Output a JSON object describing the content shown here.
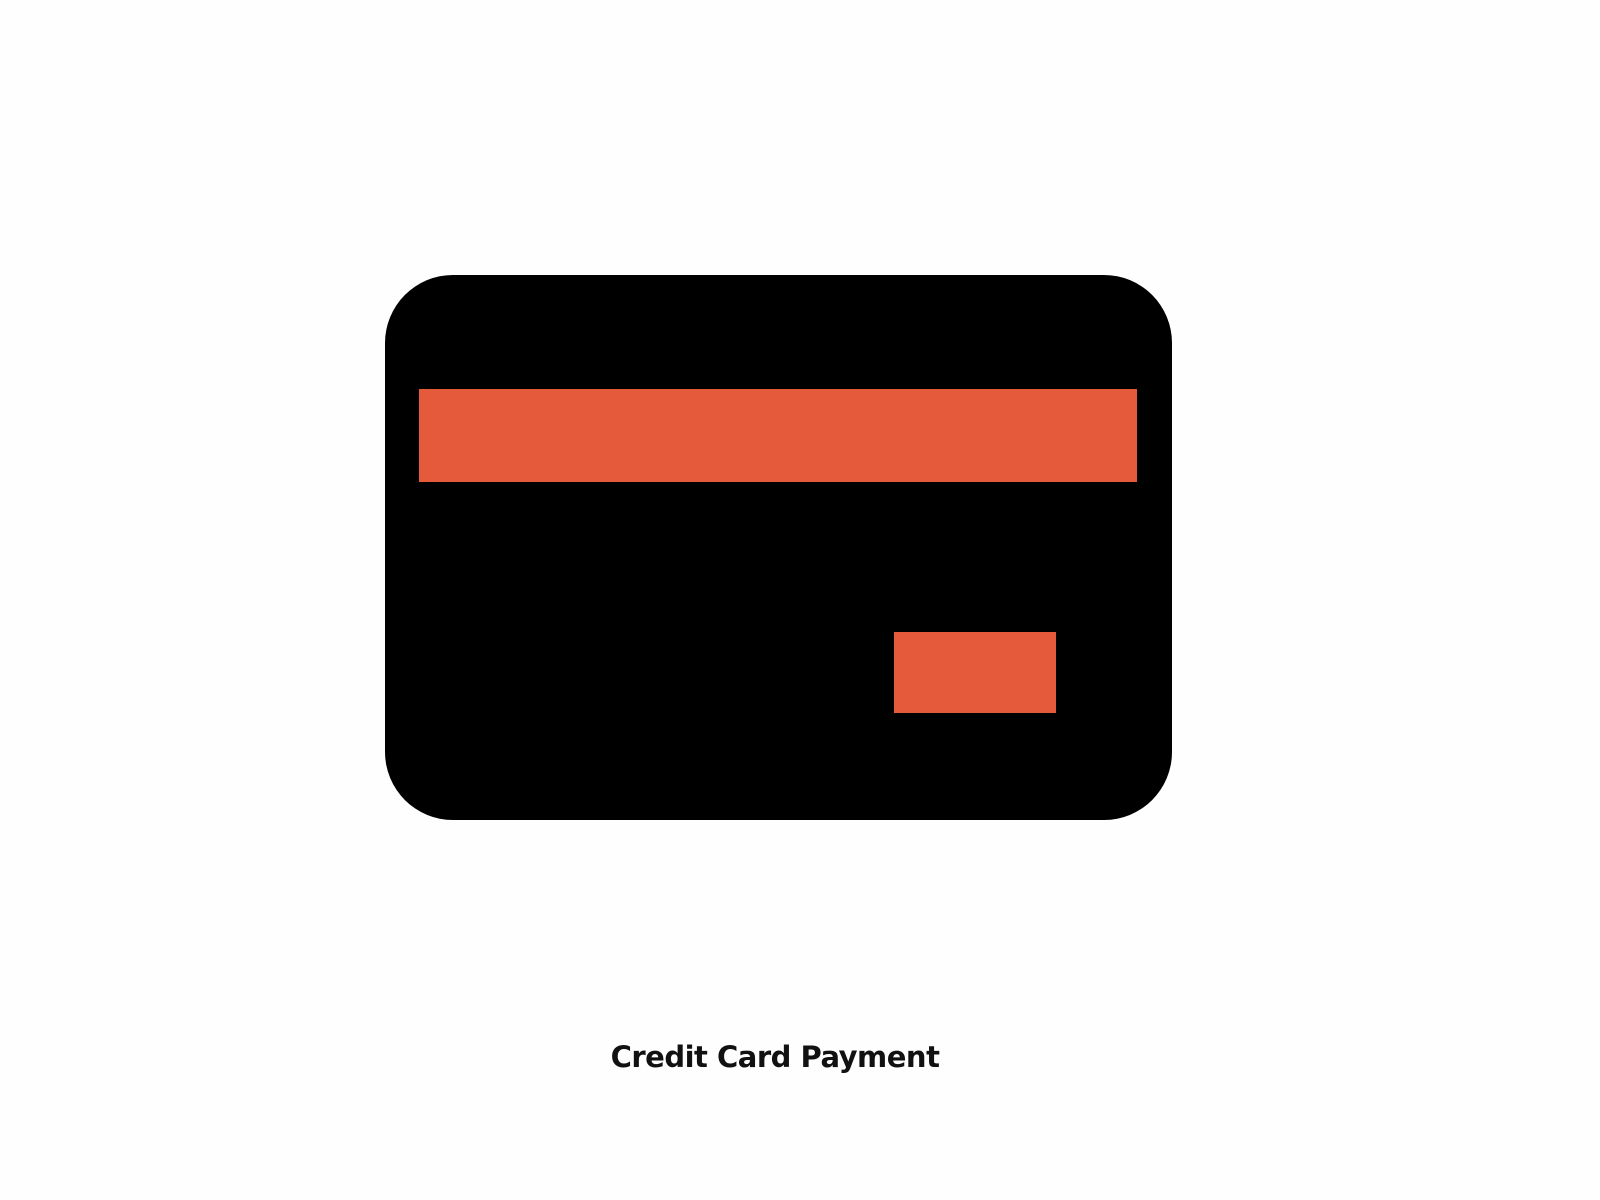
{
  "caption": {
    "text": "Credit Card Payment"
  },
  "icon": {
    "name": "credit-card-icon",
    "card_color": "#000000",
    "accent_color": "#e65a3c"
  },
  "colors": {
    "background": "#fefefe",
    "text": "#111111"
  }
}
